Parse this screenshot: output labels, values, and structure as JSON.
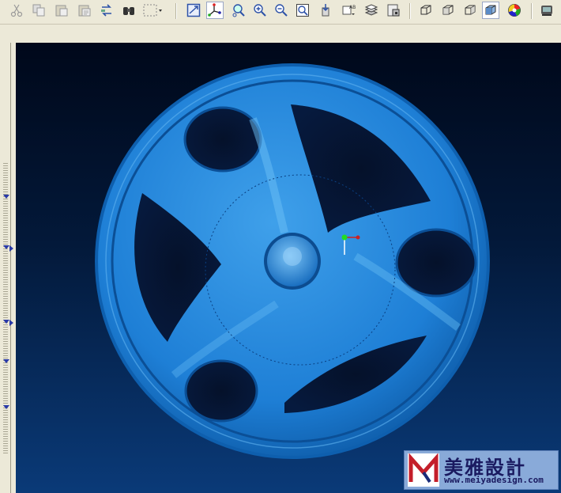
{
  "toolbar": {
    "buttons": [
      {
        "name": "cut-icon"
      },
      {
        "name": "copy-icon"
      },
      {
        "name": "paste-icon"
      },
      {
        "name": "paste-special-icon"
      },
      {
        "name": "swap-icon"
      },
      {
        "name": "find-icon"
      },
      {
        "name": "select-box-icon"
      },
      {
        "name": "zoom-fit-icon"
      },
      {
        "name": "trihedron-icon"
      },
      {
        "name": "zoom-area-icon"
      },
      {
        "name": "zoom-in-icon"
      },
      {
        "name": "zoom-out-icon"
      },
      {
        "name": "zoom-window-icon"
      },
      {
        "name": "normal-view-icon"
      },
      {
        "name": "rename-icon"
      },
      {
        "name": "layers-icon"
      },
      {
        "name": "clipboard-view-icon"
      },
      {
        "name": "iso-view-icon"
      },
      {
        "name": "front-view-icon"
      },
      {
        "name": "side-view-icon"
      },
      {
        "name": "shaded-view-icon"
      },
      {
        "name": "color-wheel-icon"
      },
      {
        "name": "render-icon"
      }
    ]
  },
  "viewport": {
    "background_top": "#00081a",
    "background_bottom": "#0a3a78",
    "model_color": "#1e7fd6"
  },
  "watermark": {
    "title": "美雅設計",
    "url": "www.meiyadesign.com"
  }
}
